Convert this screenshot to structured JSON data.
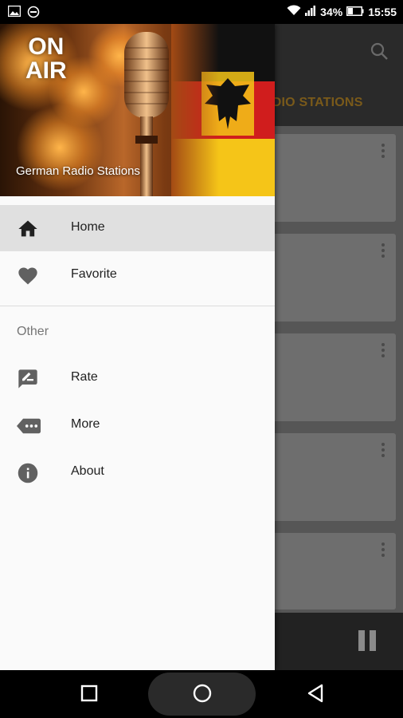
{
  "status_bar": {
    "left_icons": [
      "image-icon",
      "dnd-icon"
    ],
    "right_icons": [
      "wifi-icon",
      "signal-icon",
      "battery-icon"
    ],
    "battery_percent": "34%",
    "time": "15:55"
  },
  "background_app": {
    "tab_label": "ADIO STATIONS",
    "search_icon": "search-icon",
    "card_count": 5,
    "player_button": "pause-icon"
  },
  "drawer": {
    "header": {
      "badge_line1": "ON",
      "badge_line2": "AIR",
      "title": "German Radio Stations"
    },
    "items": [
      {
        "label": "Home",
        "icon": "home-icon",
        "active": true
      },
      {
        "label": "Favorite",
        "icon": "heart-icon",
        "active": false
      }
    ],
    "section_label": "Other",
    "other_items": [
      {
        "label": "Rate",
        "icon": "rate-icon"
      },
      {
        "label": "More",
        "icon": "more-icon"
      },
      {
        "label": "About",
        "icon": "info-icon"
      }
    ]
  },
  "nav_bar": {
    "buttons": [
      "recents-icon",
      "home-circle-icon",
      "back-icon"
    ]
  },
  "colors": {
    "drawer_bg": "#fafafa",
    "active_item_bg": "#e0e0e0",
    "icon_gray": "#616161",
    "flag_black": "#111111",
    "flag_red": "#d01d1d",
    "flag_gold": "#f5c518",
    "tab_text": "#7a5a1a"
  }
}
